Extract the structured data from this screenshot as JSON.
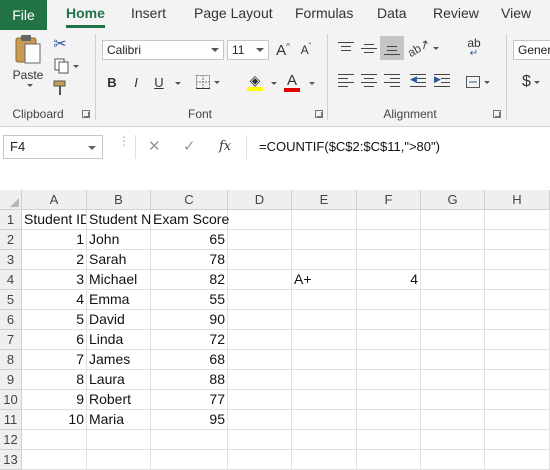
{
  "menu": {
    "file": "File",
    "tabs": [
      "Home",
      "Insert",
      "Page Layout",
      "Formulas",
      "Data",
      "Review",
      "View"
    ],
    "active_tab": "Home"
  },
  "ribbon": {
    "clipboard": {
      "label": "Clipboard",
      "paste_label": "Paste"
    },
    "font": {
      "label": "Font",
      "font_name": "Calibri",
      "font_size": "11",
      "grow_label": "A",
      "shrink_label": "A",
      "bold": "B",
      "italic": "I",
      "underline": "U",
      "font_color_label": "A",
      "highlight_color": "#ffff00",
      "font_color": "#e00000"
    },
    "alignment": {
      "label": "Alignment",
      "wrap_icon": "ab"
    },
    "number": {
      "format": "Gener",
      "currency_symbol": "$"
    }
  },
  "formula_bar": {
    "name_box": "F4",
    "cancel": "✕",
    "enter": "✓",
    "fx": "fx",
    "formula": "=COUNTIF($C$2:$C$11,\">80\")"
  },
  "sheet": {
    "columns": [
      "A",
      "B",
      "C",
      "D",
      "E",
      "F",
      "G",
      "H"
    ],
    "rows": [
      {
        "n": "1",
        "a": "Student ID",
        "b": "Student Name",
        "c": "Exam Score",
        "e": "",
        "f": ""
      },
      {
        "n": "2",
        "a": "1",
        "b": "John",
        "c": "65",
        "e": "",
        "f": ""
      },
      {
        "n": "3",
        "a": "2",
        "b": "Sarah",
        "c": "78",
        "e": "",
        "f": ""
      },
      {
        "n": "4",
        "a": "3",
        "b": "Michael",
        "c": "82",
        "e": "A+",
        "f": "4"
      },
      {
        "n": "5",
        "a": "4",
        "b": "Emma",
        "c": "55",
        "e": "",
        "f": ""
      },
      {
        "n": "6",
        "a": "5",
        "b": "David",
        "c": "90",
        "e": "",
        "f": ""
      },
      {
        "n": "7",
        "a": "6",
        "b": "Linda",
        "c": "72",
        "e": "",
        "f": ""
      },
      {
        "n": "8",
        "a": "7",
        "b": "James",
        "c": "68",
        "e": "",
        "f": ""
      },
      {
        "n": "9",
        "a": "8",
        "b": "Laura",
        "c": "88",
        "e": "",
        "f": ""
      },
      {
        "n": "10",
        "a": "9",
        "b": "Robert",
        "c": "77",
        "e": "",
        "f": ""
      },
      {
        "n": "11",
        "a": "10",
        "b": "Maria",
        "c": "95",
        "e": "",
        "f": ""
      },
      {
        "n": "12",
        "a": "",
        "b": "",
        "c": "",
        "e": "",
        "f": ""
      },
      {
        "n": "13",
        "a": "",
        "b": "",
        "c": "",
        "e": "",
        "f": ""
      }
    ],
    "accent": "#217346"
  }
}
